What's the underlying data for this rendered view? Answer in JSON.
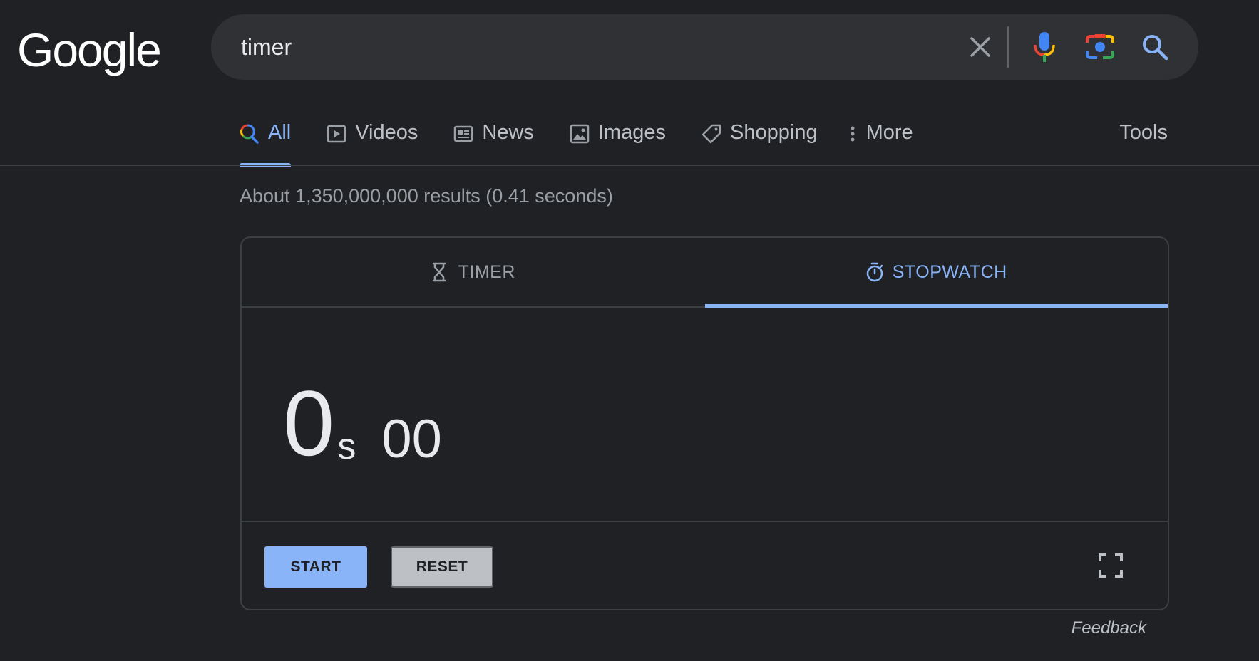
{
  "header": {
    "logo_text": "Google",
    "search": {
      "query": "timer"
    }
  },
  "tabs": [
    {
      "label": "All",
      "icon": "search-multicolor-icon",
      "active": true
    },
    {
      "label": "Videos",
      "icon": "video-play-icon"
    },
    {
      "label": "News",
      "icon": "newspaper-icon"
    },
    {
      "label": "Images",
      "icon": "image-icon"
    },
    {
      "label": "Shopping",
      "icon": "tag-icon"
    },
    {
      "label": "More",
      "icon": "more-vertical-icon"
    }
  ],
  "tools_label": "Tools",
  "result_stats": "About 1,350,000,000 results (0.41 seconds)",
  "widget": {
    "tabs": [
      {
        "label": "TIMER",
        "icon": "hourglass-icon",
        "active": false
      },
      {
        "label": "STOPWATCH",
        "icon": "stopwatch-icon",
        "active": true
      }
    ],
    "time": {
      "seconds": "0",
      "unit": "s",
      "centiseconds": "00"
    },
    "start_label": "START",
    "reset_label": "RESET",
    "fullscreen_icon": "fullscreen-icon"
  },
  "feedback_label": "Feedback",
  "colors": {
    "background": "#202124",
    "search_box": "#303134",
    "accent": "#8ab4f8",
    "text_primary": "#e8eaed",
    "text_secondary": "#bdc1c6",
    "text_muted": "#9aa0a6",
    "border": "#3c4043"
  }
}
